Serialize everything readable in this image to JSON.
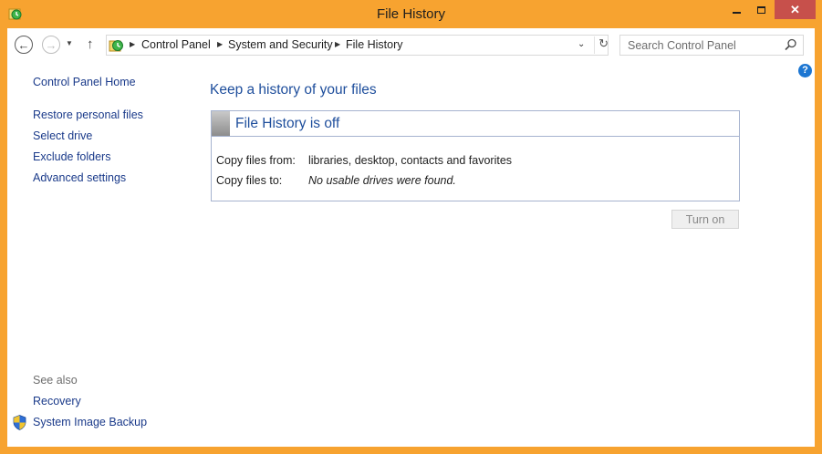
{
  "window": {
    "title": "File History",
    "controls": {
      "minimize": "minimize",
      "maximize": "maximize",
      "close": "✕"
    },
    "frame_color": "#f7a330"
  },
  "navbar": {
    "back": "←",
    "forward": "→",
    "recent": "▼",
    "up": "↑",
    "breadcrumbs": [
      "Control Panel",
      "System and Security",
      "File History"
    ],
    "refresh": "↻",
    "dropdown": "⌄",
    "search_placeholder": "Search Control Panel"
  },
  "help": "?",
  "sidebar": {
    "home": "Control Panel Home",
    "links": [
      "Restore personal files",
      "Select drive",
      "Exclude folders",
      "Advanced settings"
    ],
    "see_also": "See also",
    "see_also_links": [
      "Recovery",
      "System Image Backup"
    ]
  },
  "main": {
    "title": "Keep a history of your files",
    "status": "File History is off",
    "rows": [
      {
        "label": "Copy files from:",
        "value": "libraries, desktop, contacts and favorites"
      },
      {
        "label": "Copy files to:",
        "value": "No usable drives were found."
      }
    ],
    "turn_on": "Turn on"
  },
  "colors": {
    "link": "#1a3a8a",
    "heading": "#1e4e9c",
    "close_button": "#c7504b",
    "status_border": "#a6b3cf"
  },
  "icons": {
    "app": "file-history-icon",
    "search": "magnifier-icon",
    "shield": "uac-shield-icon",
    "help": "help-icon"
  }
}
